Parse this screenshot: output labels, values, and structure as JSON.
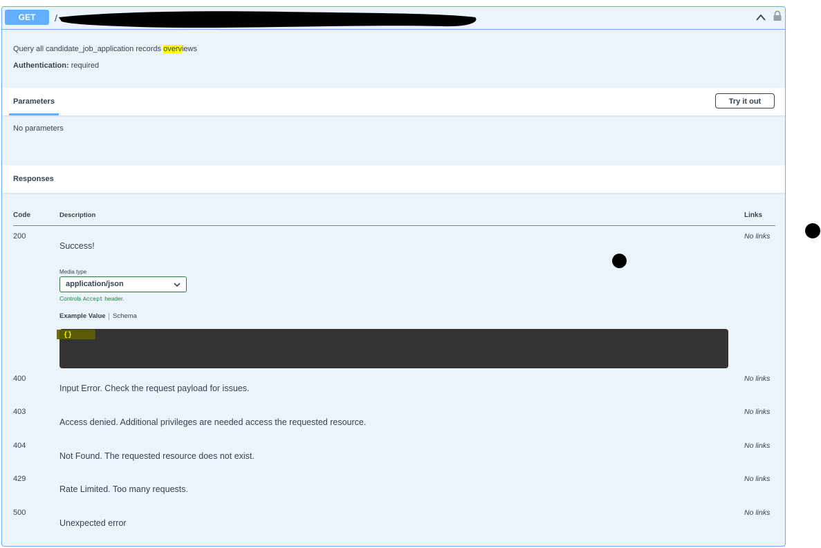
{
  "summary": {
    "method": "GET",
    "path_prefix": "/",
    "collapse_icon": "chevron-up-icon",
    "lock_icon": "lock-icon"
  },
  "description": {
    "text_before": "Query all candidate_job_application records ",
    "text_highlight": "overv",
    "text_after": "iews",
    "auth_label": "Authentication:",
    "auth_value": "required"
  },
  "parameters": {
    "tab_label": "Parameters",
    "try_button": "Try it out",
    "empty_text": "No parameters"
  },
  "responses": {
    "title": "Responses",
    "headers": {
      "code": "Code",
      "description": "Description",
      "links": "Links"
    },
    "media_type_label": "Media type",
    "media_type_value": "application/json",
    "controls_prefix": "Controls ",
    "controls_code": "Accept",
    "controls_suffix": " header.",
    "example_tab": "Example Value",
    "schema_tab": "Schema",
    "example_body": "{}",
    "rows": [
      {
        "code": "200",
        "description": "Success!",
        "links": "No links"
      },
      {
        "code": "400",
        "description": "Input Error. Check the request payload for issues.",
        "links": "No links"
      },
      {
        "code": "403",
        "description": "Access denied. Additional privileges are needed access the requested resource.",
        "links": "No links"
      },
      {
        "code": "404",
        "description": "Not Found. The requested resource does not exist.",
        "links": "No links"
      },
      {
        "code": "429",
        "description": "Rate Limited. Too many requests.",
        "links": "No links"
      },
      {
        "code": "500",
        "description": "Unexpected error",
        "links": "No links"
      }
    ]
  },
  "colors": {
    "accent": "#61affe",
    "panel_bg": "#ebf3fb",
    "code_bg": "#333333",
    "highlight": "#ffff00"
  }
}
